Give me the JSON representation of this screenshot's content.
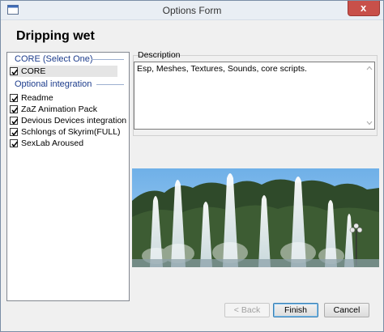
{
  "window": {
    "title": "Options Form",
    "close_glyph": "x"
  },
  "plugin_name": "Dripping wet",
  "groups": [
    {
      "header": "CORE (Select One)"
    },
    {
      "header": "Optional integration"
    }
  ],
  "options": [
    {
      "label": "CORE",
      "checked": true,
      "selected": true
    },
    {
      "label": "Readme",
      "checked": true
    },
    {
      "label": "ZaZ Animation Pack",
      "checked": true
    },
    {
      "label": "Devious Devices integration",
      "checked": true
    },
    {
      "label": "Schlongs of Skyrim(FULL)",
      "checked": true
    },
    {
      "label": "SexLab Aroused",
      "checked": true
    }
  ],
  "description": {
    "label": "Description",
    "text": "Esp, Meshes, Textures, Sounds, core scripts."
  },
  "preview_image": {
    "icon": "fountains-photo"
  },
  "buttons": {
    "back": "< Back",
    "finish": "Finish",
    "cancel": "Cancel"
  },
  "colors": {
    "group_header": "#1c3c8c",
    "close_button": "#c8504a",
    "title_bar": "#e9eef4"
  }
}
